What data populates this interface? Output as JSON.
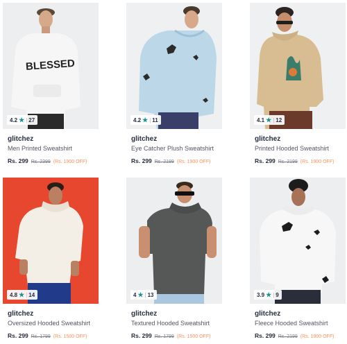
{
  "products": [
    {
      "brand": "glitchez",
      "name": "Men Printed Sweatshirt",
      "rating": "4.2",
      "reviews": "27",
      "price": "Rs. 299",
      "mrp": "Rs. 2399",
      "discount": "(Rs. 1900 OFF)",
      "print_text": "BLESSED",
      "bg": "#eceeef",
      "garment": "#f6f6f6"
    },
    {
      "brand": "glitchez",
      "name": "Eye Catcher Plush Sweatshirt",
      "rating": "4.2",
      "reviews": "11",
      "price": "Rs. 299",
      "mrp": "Rs. 2199",
      "discount": "(Rs. 1900 OFF)",
      "bg": "#eef0f1",
      "garment": "#bcd7e8"
    },
    {
      "brand": "glitchez",
      "name": "Printed Hooded Sweatshirt",
      "rating": "4.1",
      "reviews": "12",
      "price": "Rs. 299",
      "mrp": "Rs. 2199",
      "discount": "(Rs. 1900 OFF)",
      "bg": "#eef0f1",
      "garment": "#d9bd92"
    },
    {
      "brand": "glitchez",
      "name": "Oversized Hooded Sweatshirt",
      "rating": "4.8",
      "reviews": "14",
      "price": "Rs. 299",
      "mrp": "Rs. 1799",
      "discount": "(Rs. 1500 OFF)",
      "bg": "#e8472f",
      "garment": "#f4efe6"
    },
    {
      "brand": "glitchez",
      "name": "Textured Hooded Sweatshirt",
      "rating": "4",
      "reviews": "13",
      "price": "Rs. 299",
      "mrp": "Rs. 1799",
      "discount": "(Rs. 1500 OFF)",
      "bg": "#eceeef",
      "garment": "#555856"
    },
    {
      "brand": "glitchez",
      "name": "Fleece Hooded Sweatshirt",
      "rating": "3.9",
      "reviews": "9",
      "price": "Rs. 299",
      "mrp": "Rs. 2199",
      "discount": "(Rs. 1900 OFF)",
      "bg": "#eceeef",
      "garment": "#f7f7f7"
    }
  ],
  "colors": {
    "star": "#14958f",
    "discount": "#ff905a"
  }
}
